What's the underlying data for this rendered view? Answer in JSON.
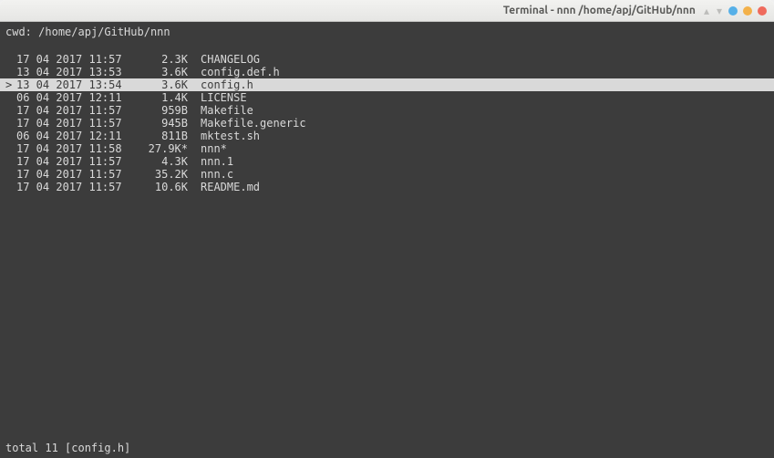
{
  "titlebar": {
    "title": "Terminal - nnn  /home/apj/GitHub/nnn"
  },
  "cwd": {
    "label": "cwd:",
    "path": "/home/apj/GitHub/nnn"
  },
  "files": [
    {
      "cursor": "  ",
      "date": "17 04 2017 11:57",
      "size": "2.3K",
      "name": "CHANGELOG",
      "selected": false
    },
    {
      "cursor": "  ",
      "date": "13 04 2017 13:53",
      "size": "3.6K",
      "name": "config.def.h",
      "selected": false
    },
    {
      "cursor": "> ",
      "date": "13 04 2017 13:54",
      "size": "3.6K",
      "name": "config.h",
      "selected": true
    },
    {
      "cursor": "  ",
      "date": "06 04 2017 12:11",
      "size": "1.4K",
      "name": "LICENSE",
      "selected": false
    },
    {
      "cursor": "  ",
      "date": "17 04 2017 11:57",
      "size": "959B",
      "name": "Makefile",
      "selected": false
    },
    {
      "cursor": "  ",
      "date": "17 04 2017 11:57",
      "size": "945B",
      "name": "Makefile.generic",
      "selected": false
    },
    {
      "cursor": "  ",
      "date": "06 04 2017 12:11",
      "size": "811B",
      "name": "mktest.sh",
      "selected": false
    },
    {
      "cursor": "  ",
      "date": "17 04 2017 11:58",
      "size": "27.9K*",
      "name": "nnn*",
      "selected": false
    },
    {
      "cursor": "  ",
      "date": "17 04 2017 11:57",
      "size": "4.3K",
      "name": "nnn.1",
      "selected": false
    },
    {
      "cursor": "  ",
      "date": "17 04 2017 11:57",
      "size": "35.2K",
      "name": "nnn.c",
      "selected": false
    },
    {
      "cursor": "  ",
      "date": "17 04 2017 11:57",
      "size": "10.6K",
      "name": "README.md",
      "selected": false
    }
  ],
  "status": {
    "text": "total 11 [config.h]"
  }
}
